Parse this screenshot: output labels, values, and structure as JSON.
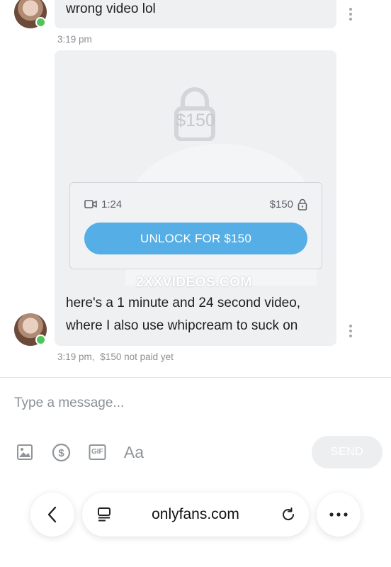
{
  "messages": [
    {
      "text": "wrong video lol",
      "time": "3:19 pm"
    },
    {
      "text_line1": "here's a 1 minute and 24 second video,",
      "text_line2": "where I also use whipcream to suck on",
      "time": "3:19 pm,",
      "payment_status": "$150 not paid yet"
    }
  ],
  "locked_media": {
    "price_overlay": "$150",
    "duration": "1:24",
    "price": "$150",
    "unlock_label": "UNLOCK FOR $150",
    "watermark": "2XXVIDEOS.COM",
    "icons": [
      "video-camera-icon",
      "lock-icon"
    ]
  },
  "composer": {
    "placeholder": "Type a message...",
    "send_label": "SEND",
    "tools": [
      "image-icon",
      "dollar-icon",
      "gif-icon",
      "text-format-icon"
    ],
    "text_format_label": "Aa",
    "gif_label": "GIF"
  },
  "browser": {
    "url": "onlyfans.com",
    "icons": [
      "back-icon",
      "tabs-icon",
      "reload-icon",
      "more-icon"
    ]
  },
  "colors": {
    "accent": "#56aee6",
    "online": "#4fc45b",
    "bubble": "#eef0f2"
  }
}
